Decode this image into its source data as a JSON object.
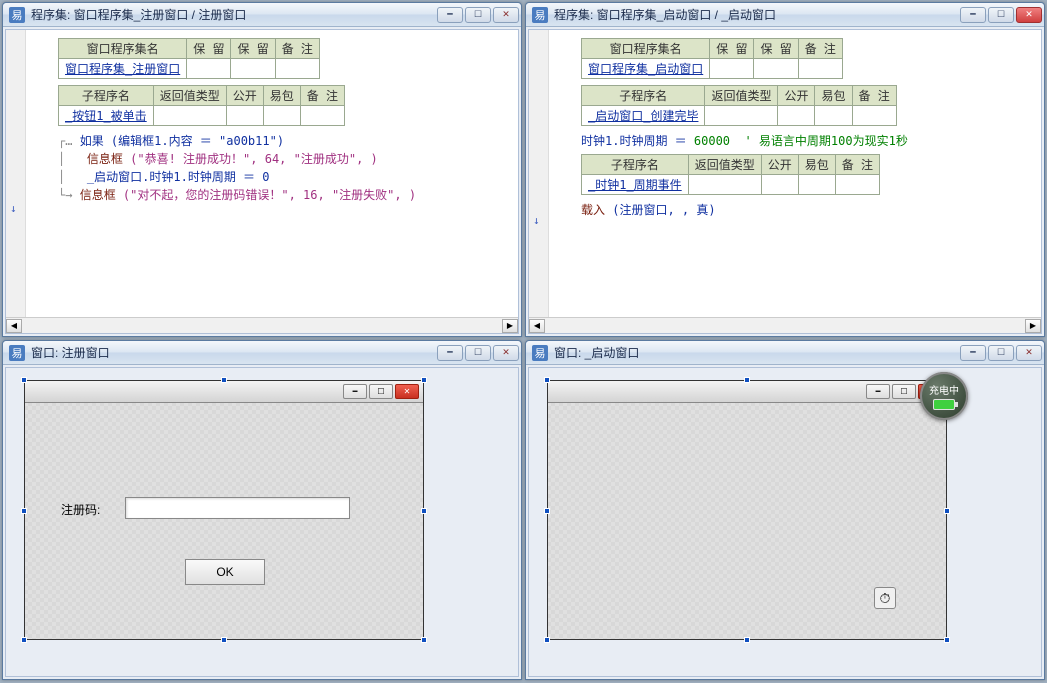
{
  "windows": {
    "tl": {
      "title": "程序集: 窗口程序集_注册窗口 / 注册窗口",
      "icon": "易"
    },
    "tr": {
      "title": "程序集: 窗口程序集_启动窗口 / _启动窗口",
      "icon": "易"
    },
    "bl": {
      "title": "窗口: 注册窗口",
      "icon": "易"
    },
    "br": {
      "title": "窗口: _启动窗口",
      "icon": "易"
    }
  },
  "columns": {
    "set_name": "窗口程序集名",
    "reserve1": "保 留",
    "reserve2": "保 留",
    "remark": "备 注",
    "sub_name": "子程序名",
    "ret_type": "返回值类型",
    "public": "公开",
    "easy": "易包"
  },
  "tl": {
    "set_value": "窗口程序集_注册窗口",
    "sub_value": "_按钮1_被单击",
    "code": {
      "l1": "如果 (编辑框1.内容 ＝ \"a00b11\")",
      "l2a": "信息框",
      "l2b": " (\"恭喜! 注册成功！\", 64, \"注册成功\", )",
      "l3": "_启动窗口.时钟1.时钟周期 ＝ 0",
      "l4a": "信息框",
      "l4b": " (\"对不起，您的注册码错误！\", 16, \"注册失败\", )"
    }
  },
  "tr": {
    "set_value": "窗口程序集_启动窗口",
    "sub_value": "_启动窗口_创建完毕",
    "code": {
      "l1a": "时钟1.时钟周期 ＝ ",
      "l1n": "60000",
      "l1c": "  ' 易语言中周期100为现实1秒",
      "l2a": "载入",
      "l2b": " (注册窗口, , 真)"
    },
    "sub2_value": "_时钟1_周期事件"
  },
  "bl_form": {
    "label": "注册码:",
    "ok": "OK"
  },
  "battery": {
    "label": "充电中"
  }
}
